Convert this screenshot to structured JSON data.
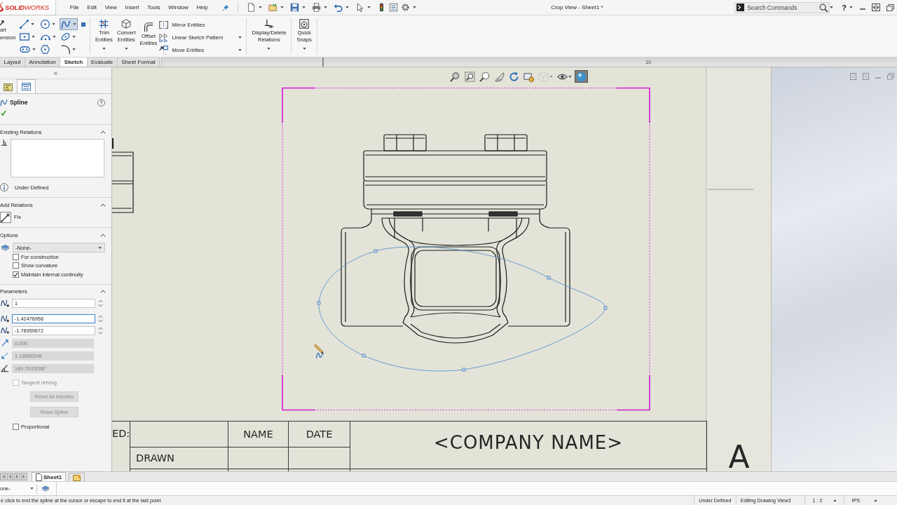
{
  "title_bar": {
    "logo": "**SOLID**WORKS",
    "menus": [
      "File",
      "Edit",
      "View",
      "Insert",
      "Tools",
      "Window",
      "Help"
    ],
    "document_title": "Crop View - Sheet1 *",
    "search": {
      "placeholder": "Search Commands"
    },
    "help": "?"
  },
  "ribbon": {
    "cut_command": [
      "art",
      "ension"
    ],
    "sketch_tools": [
      {
        "kind": "line",
        "selected": false,
        "dropdown": true
      },
      {
        "kind": "rectangle",
        "selected": false,
        "dropdown": true
      },
      {
        "kind": "slot",
        "selected": false,
        "dropdown": true
      },
      {
        "kind": "circle",
        "selected": false,
        "dropdown": true
      },
      {
        "kind": "arc",
        "selected": false,
        "dropdown": true
      },
      {
        "kind": "polygon",
        "selected": false,
        "dropdown": false
      },
      {
        "kind": "spline",
        "selected": true,
        "dropdown": true
      },
      {
        "kind": "ellipse",
        "selected": false,
        "dropdown": true
      },
      {
        "kind": "fillet",
        "selected": false,
        "dropdown": true
      },
      {
        "kind": "point",
        "selected": false,
        "dropdown": false
      }
    ],
    "commands": [
      {
        "kind": "trim",
        "label": "Trim Entities",
        "dropdown": true
      },
      {
        "kind": "convert",
        "label": "Convert Entities",
        "dropdown": true
      },
      {
        "kind": "offset",
        "label": "Offset Entities",
        "dropdown": false
      }
    ],
    "list_commands": [
      {
        "kind": "mirror",
        "label": "Mirror Entities",
        "dropdown": false
      },
      {
        "kind": "pattern",
        "label": "Linear Sketch Pattern",
        "dropdown": true
      },
      {
        "kind": "move",
        "label": "Move Entities",
        "dropdown": true
      }
    ],
    "more_commands": [
      {
        "kind": "relations",
        "label": "Display/Delete Relations",
        "dropdown": true
      },
      {
        "kind": "snaps",
        "label": "Quick Snaps",
        "dropdown": true
      }
    ]
  },
  "command_tabs": [
    {
      "label": "Layout",
      "selected": false
    },
    {
      "label": "Annotation",
      "selected": false
    },
    {
      "label": "Sketch",
      "selected": true
    },
    {
      "label": "Evaluate",
      "selected": false
    },
    {
      "label": "Sheet Format",
      "selected": false
    }
  ],
  "ruler": {
    "label": "10"
  },
  "property_manager": {
    "tabs": [
      {
        "selected": false
      },
      {
        "selected": true
      }
    ],
    "title": "Spline",
    "existing_relations": {
      "title": "Existing Relations",
      "expanded": true,
      "status": "Under Defined"
    },
    "add_relations": {
      "title": "Add Relations",
      "expanded": true,
      "relations": [
        "Fix"
      ]
    },
    "options": {
      "title": "Options",
      "expanded": true,
      "layer": "-None-",
      "checkboxes": [
        {
          "label": "For construction",
          "checked": false
        },
        {
          "label": "Show curvature",
          "checked": false
        },
        {
          "label": "Maintain internal continuity",
          "checked": true
        }
      ]
    },
    "parameters": {
      "title": "Parameters",
      "expanded": true,
      "fields": [
        {
          "kind": "point",
          "value": "1",
          "focused": false,
          "disabled": false
        },
        {
          "kind": "x",
          "value": "-1.42476958",
          "focused": true,
          "disabled": false
        },
        {
          "kind": "y",
          "value": "-1.78959672",
          "focused": false,
          "disabled": false
        },
        {
          "kind": "weight-out",
          "value": "0.000",
          "focused": false,
          "disabled": true
        },
        {
          "kind": "weight-in",
          "value": "1.16586548",
          "focused": false,
          "disabled": true
        },
        {
          "kind": "angle",
          "value": "149.7035266°",
          "focused": false,
          "disabled": true
        }
      ],
      "tangent_driving": {
        "label": "Tangent driving",
        "checked": false,
        "disabled": true
      },
      "buttons": [
        {
          "label": "Reset All Handles",
          "disabled": true
        },
        {
          "label": "Relax Spline",
          "disabled": true
        }
      ],
      "proportional": {
        "label": "Proportional",
        "checked": false
      }
    }
  },
  "graphics": {
    "view_toolbar": [
      {
        "kind": "zoom-fit",
        "selected": false,
        "disabled": false,
        "dropdown": false
      },
      {
        "kind": "zoom-area",
        "selected": false,
        "disabled": false,
        "dropdown": false
      },
      {
        "kind": "previous-view",
        "selected": false,
        "disabled": false,
        "dropdown": false
      },
      {
        "kind": "section",
        "selected": false,
        "disabled": false,
        "dropdown": false
      },
      {
        "kind": "rotate",
        "selected": false,
        "disabled": false,
        "dropdown": false
      },
      {
        "kind": "view-settings",
        "selected": false,
        "disabled": false,
        "dropdown": false
      },
      {
        "kind": "orientation",
        "selected": false,
        "disabled": true,
        "dropdown": true
      },
      {
        "kind": "hide-show",
        "selected": false,
        "disabled": false,
        "dropdown": true
      },
      {
        "kind": "appearance",
        "selected": true,
        "disabled": false,
        "dropdown": false
      }
    ],
    "title_block": {
      "cut_label": "ED:",
      "name_heading": "NAME",
      "date_heading": "DATE",
      "drawn_label": "DRAWN",
      "company": "<COMPANY NAME>",
      "size": "A"
    }
  },
  "sheet_tabs": [
    {
      "label": "Sheet1",
      "selected": true
    }
  ],
  "layer_dropdown": "one-",
  "status_bar": {
    "message": "e click to end the spline at the cursor or escape to end it at the last point",
    "fields": [
      "Under Defined",
      "Editing Drawing View3"
    ],
    "scale": "1 : 2",
    "units": "IPS"
  }
}
